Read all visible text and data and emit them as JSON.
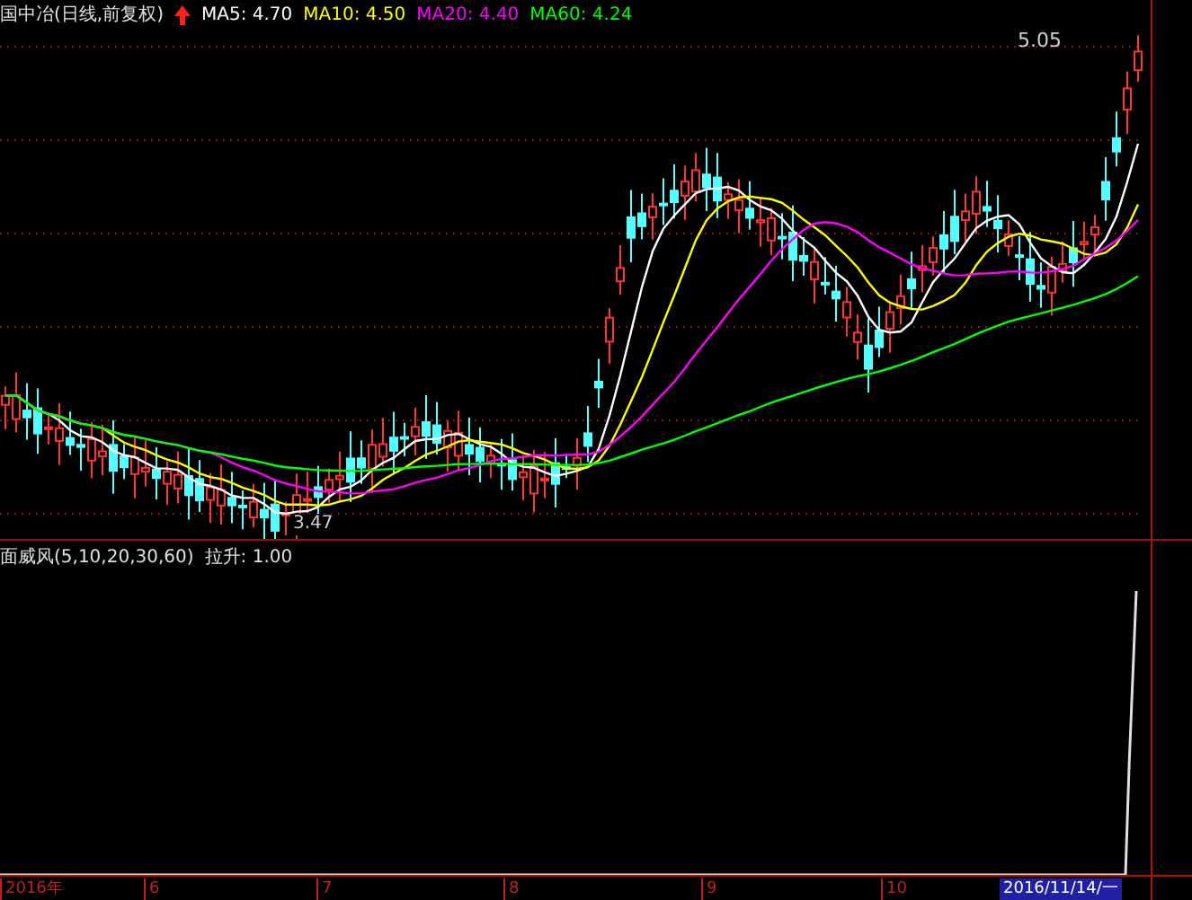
{
  "header": {
    "title": "国中冶(日线,前复权)",
    "ma": [
      {
        "label": "MA5: 4.70",
        "color": "#ffffff"
      },
      {
        "label": "MA10: 4.50",
        "color": "#ffff00"
      },
      {
        "label": "MA20: 4.40",
        "color": "#ff00ff"
      },
      {
        "label": "MA60: 4.24",
        "color": "#00ff00"
      }
    ]
  },
  "price_chart": {
    "high_label": "5.05",
    "low_label": "3.47"
  },
  "indicator": {
    "name": "面威风(5,10,20,30,60)",
    "value": "拉升: 1.00"
  },
  "time_axis": {
    "labels": [
      "2016年",
      "6",
      "7",
      "8",
      "9",
      "10"
    ],
    "cursor_date": "2016/11/14/一"
  }
}
